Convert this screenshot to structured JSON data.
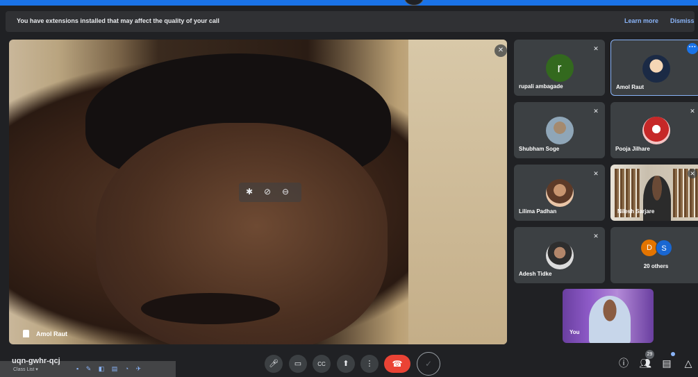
{
  "banner": {
    "message": "You have extensions installed that may affect the quality of your call",
    "learn_more": "Learn more",
    "dismiss": "Dismiss"
  },
  "main_video": {
    "participant": "Amol Raut"
  },
  "participants": [
    {
      "name": "rupali ambagade",
      "avatar_letter": "r",
      "avatar_color": "#33691e"
    },
    {
      "name": "Amol Raut"
    },
    {
      "name": "Shubham Soge"
    },
    {
      "name": "Pooja Jilhare"
    },
    {
      "name": "Lilima Padhan"
    },
    {
      "name": "Nilesh Sarjare"
    },
    {
      "name": "Adesh Tidke"
    }
  ],
  "others_tile": {
    "letter1": "D",
    "letter2": "S",
    "label": "20 others"
  },
  "self_view": {
    "label": "You"
  },
  "bottom_bar": {
    "meeting_code": "uqn-gwhr-qcj",
    "overlay_text": "Class List ▾",
    "participant_count": "29",
    "end_call_color": "#ea4335"
  },
  "icons": {
    "mic": "microphone-icon",
    "camera": "camera-icon",
    "captions": "captions-icon",
    "present": "present-icon",
    "more": "more-vert-icon",
    "end": "end-call-icon",
    "info": "info-icon",
    "people": "people-icon",
    "chat": "chat-icon",
    "activities": "activities-icon"
  }
}
